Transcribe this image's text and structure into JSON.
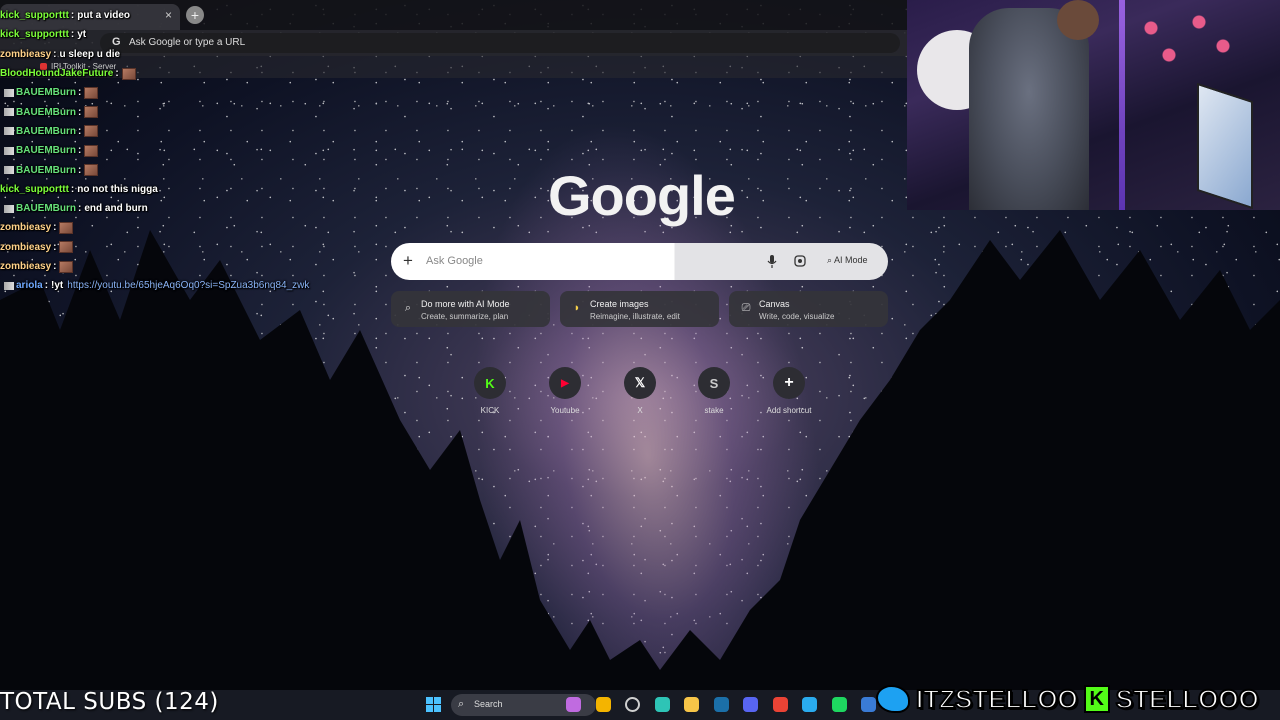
{
  "browser": {
    "omnibox_placeholder": "Ask Google or type a URL",
    "omnibox_g": "G",
    "bookmark_label": "IRLToolkit - Server",
    "tab_close": "×",
    "new_tab": "+"
  },
  "google": {
    "logo": "Google",
    "search_plus": "+",
    "search_placeholder": "Ask Google",
    "ai_mode_label": "AI Mode",
    "chips": [
      {
        "title": "Do more with AI Mode",
        "subtitle": "Create, summarize, plan",
        "icon": "ai-search-icon"
      },
      {
        "title": "Create images",
        "subtitle": "Reimagine, illustrate, edit",
        "icon": "banana-icon"
      },
      {
        "title": "Canvas",
        "subtitle": "Write, code, visualize",
        "icon": "canvas-icon"
      }
    ],
    "shortcuts": [
      {
        "glyph": "K",
        "label": "KICK",
        "color": "#53fc18"
      },
      {
        "glyph": "▶",
        "label": "Youtube",
        "color": "#ff0033"
      },
      {
        "glyph": "𝕏",
        "label": "X",
        "color": "#ffffff"
      },
      {
        "glyph": "S",
        "label": "stake",
        "color": "#cccccc"
      },
      {
        "glyph": "+",
        "label": "Add shortcut",
        "color": "#ffffff"
      }
    ]
  },
  "chat": [
    {
      "user": "kick_supporttt",
      "color": "#7dff3a",
      "text": "put a video"
    },
    {
      "user": "kick_supporttt",
      "color": "#7dff3a",
      "text": "yt"
    },
    {
      "user": "zombieasy",
      "color": "#ffd28a",
      "text": "u sleep u die"
    },
    {
      "user": "BloodHoundJakeFuture",
      "color": "#7dff3a",
      "text": "",
      "emote": true
    },
    {
      "user": "BAUEMBurn",
      "color": "#66e07a",
      "text": "",
      "emote": true,
      "badge": true
    },
    {
      "user": "BAUEMBurn",
      "color": "#66e07a",
      "text": "",
      "emote": true,
      "badge": true
    },
    {
      "user": "BAUEMBurn",
      "color": "#66e07a",
      "text": "",
      "emote": true,
      "badge": true
    },
    {
      "user": "BAUEMBurn",
      "color": "#66e07a",
      "text": "",
      "emote": true,
      "badge": true
    },
    {
      "user": "BAUEMBurn",
      "color": "#66e07a",
      "text": "",
      "emote": true,
      "badge": true
    },
    {
      "user": "kick_supporttt",
      "color": "#7dff3a",
      "text": "no not this nigga"
    },
    {
      "user": "BAUEMBurn",
      "color": "#66e07a",
      "text": "end and burn",
      "badge": true
    },
    {
      "user": "zombieasy",
      "color": "#ffd28a",
      "text": "",
      "emote": true
    },
    {
      "user": "zombieasy",
      "color": "#ffd28a",
      "text": "",
      "emote": true
    },
    {
      "user": "zombieasy",
      "color": "#ffd28a",
      "text": "",
      "emote": true
    },
    {
      "user": "ariola",
      "color": "#6fa8ff",
      "text": "!yt",
      "link": "https://youtu.be/65hjeAq6Oq0?si=SpZua3b6nq84_zwk",
      "badge": true
    }
  ],
  "taskbar": {
    "search_label": "Search",
    "icons": [
      {
        "name": "copilot-icon",
        "color": "#c06be0"
      },
      {
        "name": "chrome-canary-icon",
        "color": "#f4b400"
      },
      {
        "name": "task-view-icon",
        "color": "#cfcfcf"
      },
      {
        "name": "edge-icon",
        "color": "#2ec4b6"
      },
      {
        "name": "file-explorer-icon",
        "color": "#f7c548"
      },
      {
        "name": "steam-icon",
        "color": "#1b6fa8"
      },
      {
        "name": "discord-icon",
        "color": "#5865f2"
      },
      {
        "name": "chrome-icon",
        "color": "#ea4335"
      },
      {
        "name": "telegram-icon",
        "color": "#2aabee"
      },
      {
        "name": "spotify-icon",
        "color": "#1ed760"
      },
      {
        "name": "steam-alt-icon",
        "color": "#3a7bd5"
      }
    ]
  },
  "overlay": {
    "total_subs": "TOTAL SUBS (124)",
    "twitter_handle": "ITZSTELLOO",
    "kick_handle": "STELLOOO",
    "kick_glyph": "K"
  }
}
